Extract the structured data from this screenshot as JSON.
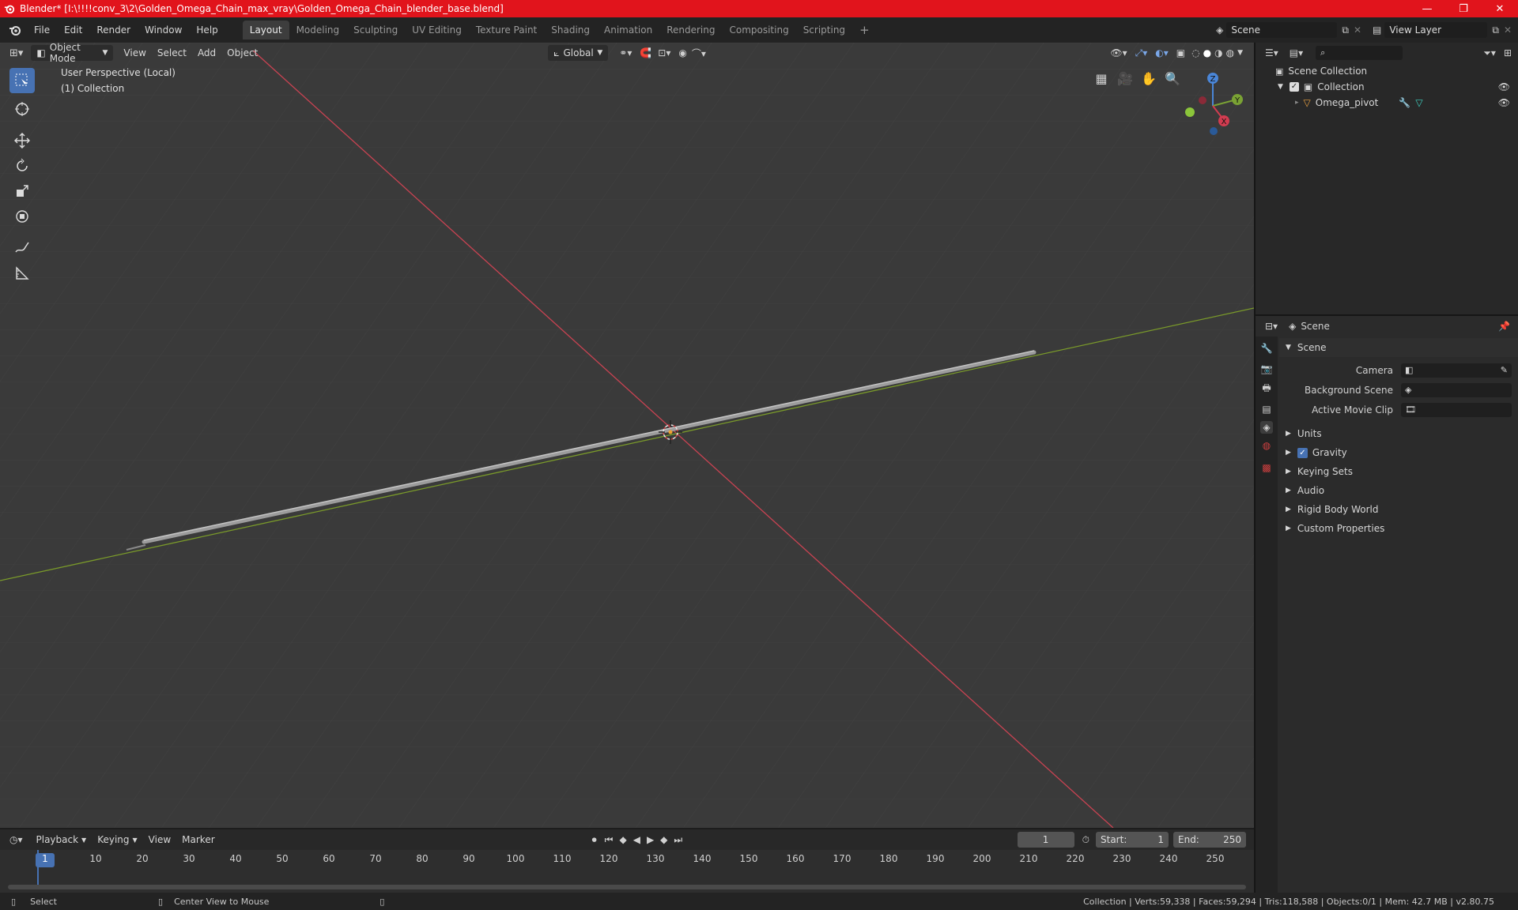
{
  "window": {
    "title": "Blender* [I:\\!!!!conv_3\\2\\Golden_Omega_Chain_max_vray\\Golden_Omega_Chain_blender_base.blend]",
    "minimize": "—",
    "maximize": "❐",
    "close": "✕"
  },
  "menubar": {
    "menus": [
      "File",
      "Edit",
      "Render",
      "Window",
      "Help"
    ],
    "workspaces": [
      "Layout",
      "Modeling",
      "Sculpting",
      "UV Editing",
      "Texture Paint",
      "Shading",
      "Animation",
      "Rendering",
      "Compositing",
      "Scripting"
    ],
    "add_workspace": "+",
    "scene": "Scene",
    "view_layer": "View Layer"
  },
  "viewport": {
    "mode": "Object Mode",
    "menus": [
      "View",
      "Select",
      "Add",
      "Object"
    ],
    "orientation": "Global",
    "overlay_title": "User Perspective (Local)",
    "overlay_collection": "(1) Collection",
    "gizmo": {
      "z": "Z",
      "y": "Y",
      "x": "X"
    }
  },
  "outliner": {
    "search_placeholder": "",
    "scene_collection": "Scene Collection",
    "collection": "Collection",
    "object": "Omega_pivot"
  },
  "properties": {
    "context": "Scene",
    "panel_title": "Scene",
    "camera_label": "Camera",
    "background_scene_label": "Background Scene",
    "active_clip_label": "Active Movie Clip",
    "subpanels": [
      "Units",
      "Gravity",
      "Keying Sets",
      "Audio",
      "Rigid Body World",
      "Custom Properties"
    ],
    "gravity_checked": true
  },
  "timeline": {
    "menus": [
      "Playback",
      "Keying",
      "View",
      "Marker"
    ],
    "current_frame": "1",
    "start_label": "Start:",
    "start": "1",
    "end_label": "End:",
    "end": "250",
    "ticks": [
      "1",
      "10",
      "20",
      "30",
      "40",
      "50",
      "60",
      "70",
      "80",
      "90",
      "100",
      "110",
      "120",
      "130",
      "140",
      "150",
      "160",
      "170",
      "180",
      "190",
      "200",
      "210",
      "220",
      "230",
      "240",
      "250"
    ]
  },
  "statusbar": {
    "select": "Select",
    "center_view": "Center View to Mouse",
    "stats": "Collection | Verts:59,338 | Faces:59,294 | Tris:118,588 | Objects:0/1 | Mem: 42.7 MB | v2.80.75"
  },
  "colors": {
    "title_red": "#e1141c",
    "accent_blue": "#4772b3",
    "axis_red": "#c94352",
    "axis_green": "#7a9a2a"
  }
}
